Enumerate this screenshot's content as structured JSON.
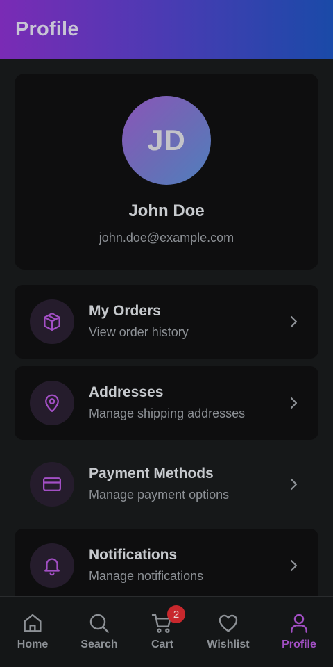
{
  "header": {
    "title": "Profile"
  },
  "profile": {
    "initials": "JD",
    "name": "John Doe",
    "email": "john.doe@example.com"
  },
  "menu": [
    {
      "title": "My Orders",
      "subtitle": "View order history",
      "icon": "package-icon"
    },
    {
      "title": "Addresses",
      "subtitle": "Manage shipping addresses",
      "icon": "map-pin-icon"
    },
    {
      "title": "Payment Methods",
      "subtitle": "Manage payment options",
      "icon": "credit-card-icon"
    },
    {
      "title": "Notifications",
      "subtitle": "Manage notifications",
      "icon": "bell-icon"
    }
  ],
  "nav": {
    "items": [
      {
        "label": "Home",
        "icon": "home-icon"
      },
      {
        "label": "Search",
        "icon": "search-icon"
      },
      {
        "label": "Cart",
        "icon": "cart-icon",
        "badge": "2"
      },
      {
        "label": "Wishlist",
        "icon": "heart-icon"
      },
      {
        "label": "Profile",
        "icon": "user-icon",
        "active": true
      }
    ]
  },
  "colors": {
    "accent": "#a24fc4",
    "badge": "#c8282d",
    "header_gradient_start": "#7a2bb5",
    "header_gradient_end": "#1a4aa8"
  }
}
